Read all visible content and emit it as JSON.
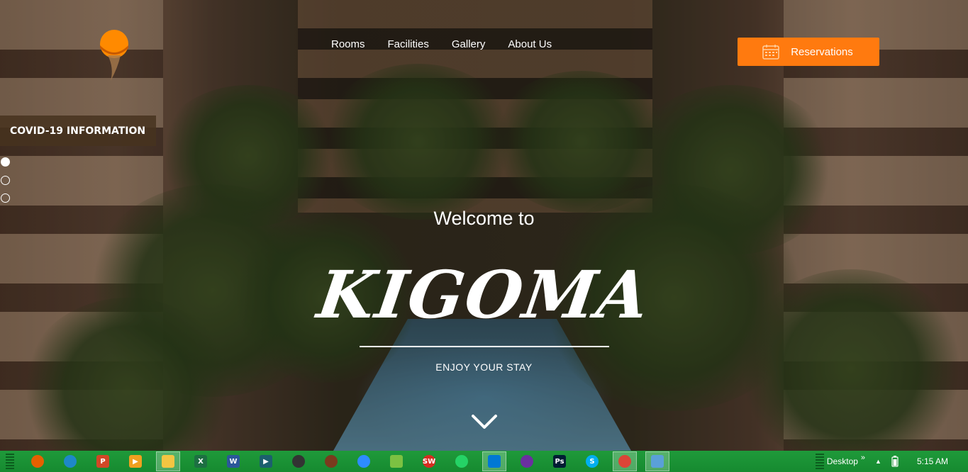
{
  "nav": {
    "items": [
      {
        "label": "Rooms"
      },
      {
        "label": "Facilities"
      },
      {
        "label": "Gallery"
      },
      {
        "label": "About Us"
      }
    ],
    "reserve_label": "Reservations"
  },
  "covid_label": "COVID-19 INFORMATION",
  "slider": {
    "count": 3,
    "active_index": 0
  },
  "hero": {
    "welcome": "Welcome to",
    "brand": "KIGOMA",
    "tagline": "ENJOY YOUR STAY"
  },
  "colors": {
    "accent": "#ff7a0f",
    "taskbar": "#1a9134",
    "covid_bg": "#46321e"
  },
  "taskbar": {
    "apps": [
      {
        "icon": "firefox-icon",
        "glyph": "",
        "color": "#e66000",
        "round": true,
        "active": false
      },
      {
        "icon": "edge-icon",
        "glyph": "",
        "color": "#1e88c8",
        "round": true,
        "active": false
      },
      {
        "icon": "powerpoint-icon",
        "glyph": "P",
        "color": "#d24726",
        "round": false,
        "active": false
      },
      {
        "icon": "media-player-icon",
        "glyph": "▶",
        "color": "#f0a020",
        "round": false,
        "active": false
      },
      {
        "icon": "file-explorer-icon",
        "glyph": "",
        "color": "#f4c542",
        "round": false,
        "active": true
      },
      {
        "icon": "excel-icon",
        "glyph": "X",
        "color": "#1d6f42",
        "round": false,
        "active": false
      },
      {
        "icon": "word-icon",
        "glyph": "W",
        "color": "#2b579a",
        "round": false,
        "active": false
      },
      {
        "icon": "media-app-icon",
        "glyph": "▶",
        "color": "#1c5f6e",
        "round": false,
        "active": false
      },
      {
        "icon": "obs-icon",
        "glyph": "",
        "color": "#333333",
        "round": true,
        "active": false
      },
      {
        "icon": "chrome-ring-icon",
        "glyph": "",
        "color": "#7a3b1e",
        "round": true,
        "active": false
      },
      {
        "icon": "zoom-icon",
        "glyph": "",
        "color": "#2d8cff",
        "round": true,
        "active": false
      },
      {
        "icon": "notepad-icon",
        "glyph": "",
        "color": "#7cc142",
        "round": false,
        "active": false
      },
      {
        "icon": "sw-icon",
        "glyph": "SW",
        "color": "#d62d20",
        "round": true,
        "active": false
      },
      {
        "icon": "whatsapp-icon",
        "glyph": "",
        "color": "#25d366",
        "round": true,
        "active": false
      },
      {
        "icon": "vscode-icon",
        "glyph": "",
        "color": "#0078d4",
        "round": false,
        "active": true
      },
      {
        "icon": "app-purple-icon",
        "glyph": "",
        "color": "#6b2fa0",
        "round": true,
        "active": false
      },
      {
        "icon": "photoshop-icon",
        "glyph": "Ps",
        "color": "#001d34",
        "round": false,
        "active": false
      },
      {
        "icon": "skype-icon",
        "glyph": "S",
        "color": "#00aff0",
        "round": true,
        "active": false
      },
      {
        "icon": "chrome-icon",
        "glyph": "",
        "color": "#db4437",
        "round": true,
        "active": true
      },
      {
        "icon": "remote-desktop-icon",
        "glyph": "",
        "color": "#5aa0d8",
        "round": false,
        "active": true
      }
    ],
    "desktop_label": "Desktop",
    "clock": "5:15 AM"
  }
}
